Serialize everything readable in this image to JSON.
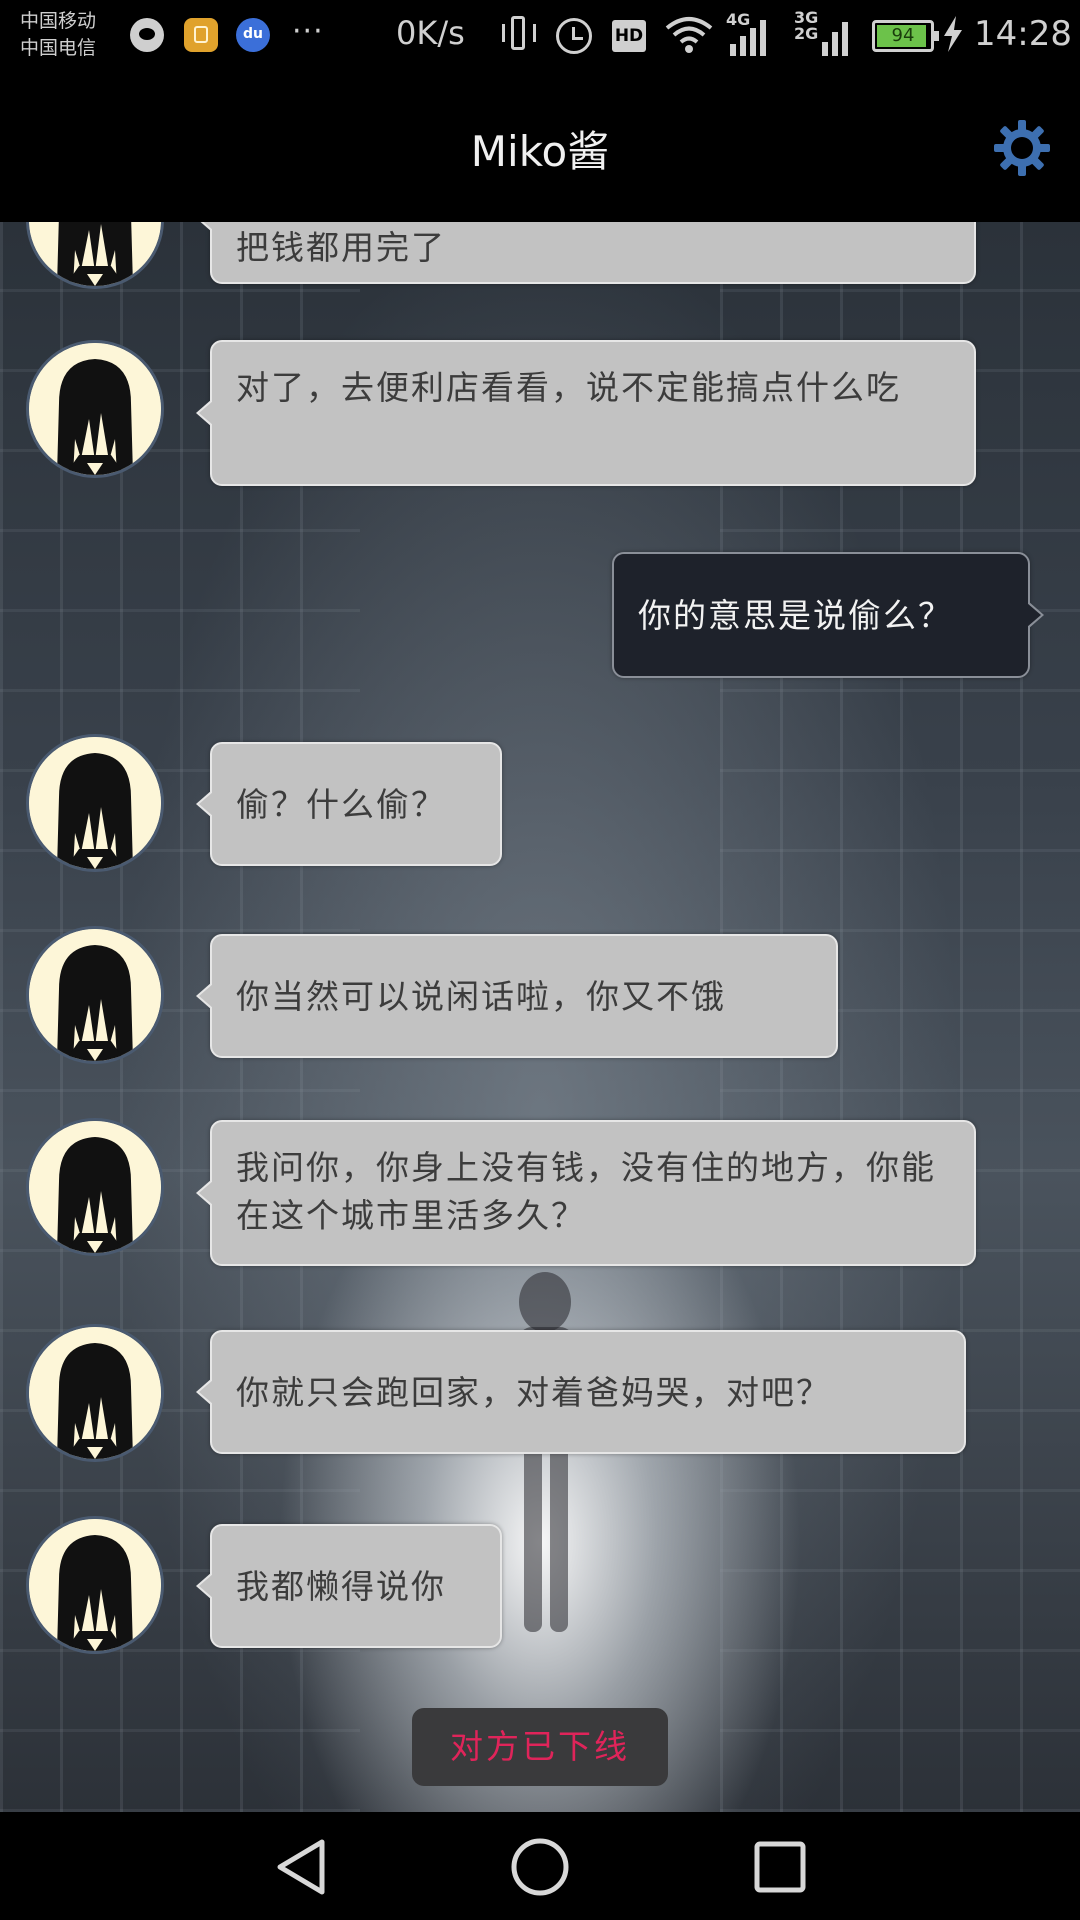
{
  "status_bar": {
    "carrier_1": "中国移动",
    "carrier_2": "中国电信",
    "more": "···",
    "net_speed": "0K/s",
    "hd": "HD",
    "signal_1_label": "4G",
    "signal_2_label": "3G\n2G",
    "battery_level": "94",
    "battery_fraction": 0.94,
    "time": "14:28",
    "icons": [
      "chat-notification-icon",
      "wallet-notification-icon",
      "baidu-notification-icon",
      "vibrate-icon",
      "alarm-icon",
      "hd-icon",
      "wifi-icon",
      "signal-icon",
      "battery-icon",
      "charging-icon"
    ]
  },
  "header": {
    "title": "Miko酱",
    "settings_icon": "gear-icon"
  },
  "messages": [
    {
      "sender": "other",
      "text": "把钱都用完了"
    },
    {
      "sender": "other",
      "text": "对了，去便利店看看，说不定能搞点什么吃"
    },
    {
      "sender": "self",
      "text": "你的意思是说偷么？"
    },
    {
      "sender": "other",
      "text": "偷？什么偷？"
    },
    {
      "sender": "other",
      "text": "你当然可以说闲话啦，你又不饿"
    },
    {
      "sender": "other",
      "text": "我问你，你身上没有钱，没有住的地方，你能在这个城市里活多久？"
    },
    {
      "sender": "other",
      "text": "你就只会跑回家，对着爸妈哭，对吧？"
    },
    {
      "sender": "other",
      "text": "我都懒得说你"
    }
  ],
  "status_notice": "对方已下线",
  "colors": {
    "other_bubble": "#c2c2c2",
    "self_bubble": "#1e222b",
    "notice_text": "#e0245a",
    "gear": "#3d6fb0",
    "avatar_bg": "#fdf6d8"
  },
  "nav": {
    "back_icon": "back-triangle-icon",
    "home_icon": "home-circle-icon",
    "recent_icon": "recent-square-icon"
  }
}
